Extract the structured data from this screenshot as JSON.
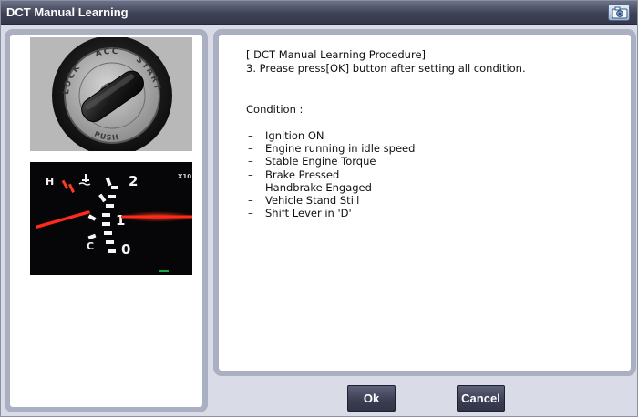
{
  "window": {
    "title": "DCT Manual Learning"
  },
  "icons": {
    "camera": "camera-icon"
  },
  "content": {
    "procedure_title": "[ DCT Manual Learning Procedure]",
    "procedure_step": "3. Prease press[OK] button after setting all condition.",
    "condition_label": "Condition :",
    "conditions": [
      "Ignition ON",
      "Engine running in idle speed",
      "Stable Engine Torque",
      "Brake Pressed",
      "Handbrake Engaged",
      "Vehicle Stand Still",
      "Shift Lever in 'D'"
    ]
  },
  "ignition_switch": {
    "positions": [
      "LOCK",
      "ACC",
      "START",
      "PUSH"
    ]
  },
  "gauge": {
    "labels": {
      "hot": "H",
      "cold": "C",
      "scale_2": "2",
      "scale_1": "1",
      "scale_0": "0",
      "multiplier": "X10"
    }
  },
  "buttons": {
    "ok": "Ok",
    "cancel": "Cancel"
  },
  "colors": {
    "titlebar": "#3f4256",
    "panel_border": "#aab0c2",
    "button": "#3b3e52",
    "needle": "#ff2a1a"
  }
}
